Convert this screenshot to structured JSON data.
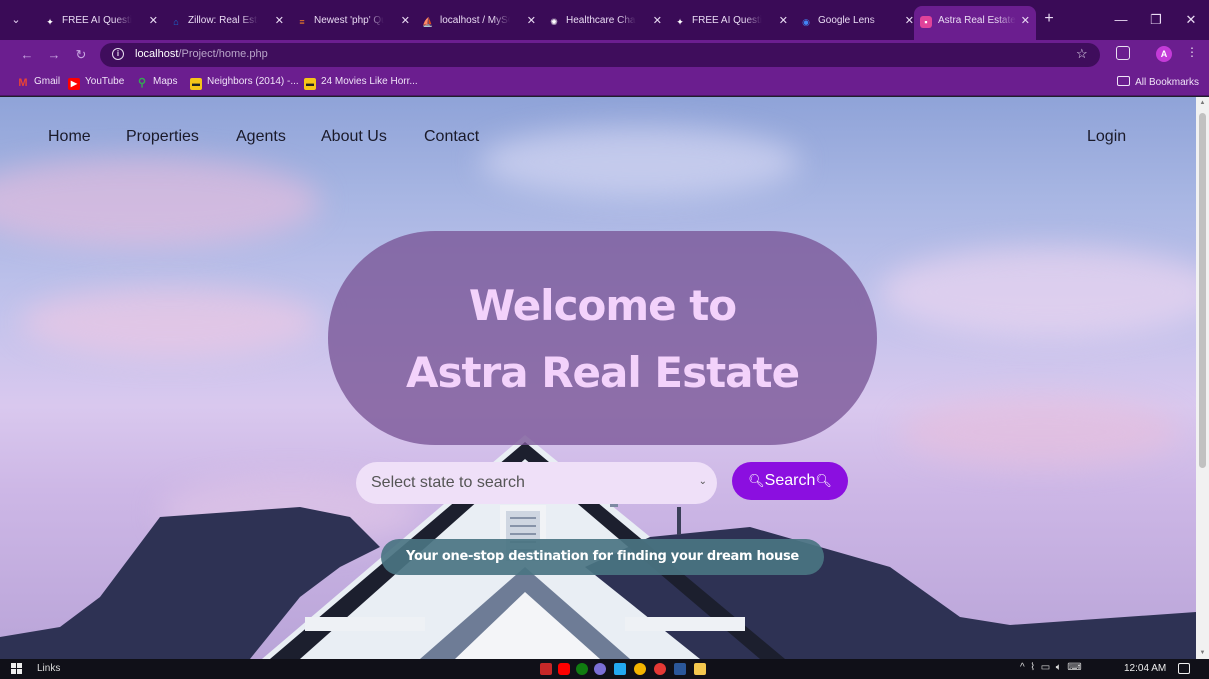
{
  "browser": {
    "tabs": [
      {
        "title": "FREE AI Question",
        "icon": "ai-sparkle-icon",
        "color": "#f5f5f5"
      },
      {
        "title": "Zillow: Real Estate",
        "icon": "zillow-icon",
        "color": "#1277e1"
      },
      {
        "title": "Newest 'php' Qu",
        "icon": "stackoverflow-icon",
        "color": "#f48024"
      },
      {
        "title": "localhost / MySQL",
        "icon": "phpmyadmin-icon",
        "color": "#f7a21b"
      },
      {
        "title": "Healthcare Chatb",
        "icon": "chatgpt-icon",
        "color": "#ffffff"
      },
      {
        "title": "FREE AI Question",
        "icon": "ai-sparkle-icon",
        "color": "#f5f5f5"
      },
      {
        "title": "Google Lens",
        "icon": "google-lens-icon",
        "color": "#4285f4"
      },
      {
        "title": "Astra Real Estate",
        "icon": "astra-icon",
        "color": "#e0439a",
        "active": true
      }
    ],
    "address": {
      "host": "localhost",
      "path": "/Project/home.php"
    },
    "bookmarks": [
      {
        "label": "Gmail",
        "icon": "gmail-icon",
        "color": "#ea4335"
      },
      {
        "label": "YouTube",
        "icon": "youtube-icon",
        "color": "#ff0000"
      },
      {
        "label": "Maps",
        "icon": "maps-icon",
        "color": "#34a853"
      },
      {
        "label": "Neighbors (2014) -...",
        "icon": "imdb-icon",
        "color": "#f5c518"
      },
      {
        "label": "24 Movies Like Horr...",
        "icon": "imdb-icon",
        "color": "#f5c518"
      }
    ],
    "all_bookmarks": "All Bookmarks",
    "profile_initial": "A"
  },
  "page": {
    "nav": [
      "Home",
      "Properties",
      "Agents",
      "About Us",
      "Contact"
    ],
    "login": "Login",
    "hero_line1": "Welcome to",
    "hero_line2": "Astra Real Estate",
    "search_placeholder": "Select state to search",
    "search_label": "Search",
    "tagline": "Your one-stop destination for finding your dream house"
  },
  "taskbar": {
    "links": "Links",
    "clock": "12:04 AM"
  }
}
